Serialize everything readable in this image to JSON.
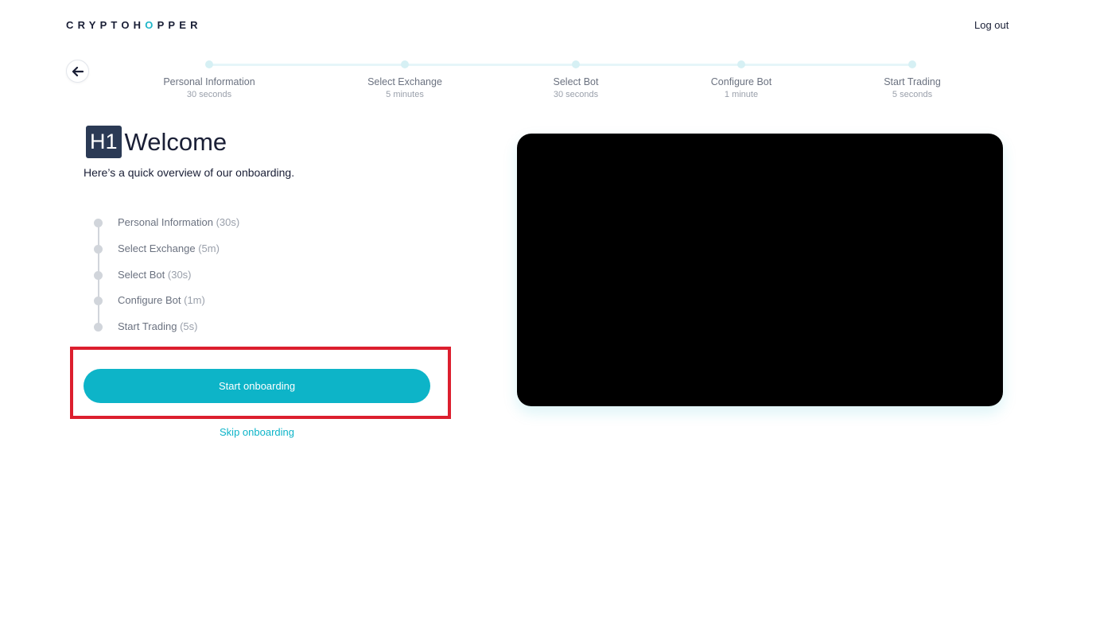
{
  "header": {
    "logo_text_1": "CRYPTOH",
    "logo_text_2": "O",
    "logo_text_3": "PPER",
    "logout_label": "Log out"
  },
  "stepper": {
    "steps": [
      {
        "label": "Personal Information",
        "duration": "30 seconds"
      },
      {
        "label": "Select Exchange",
        "duration": "5 minutes"
      },
      {
        "label": "Select Bot",
        "duration": "30 seconds"
      },
      {
        "label": "Configure Bot",
        "duration": "1 minute"
      },
      {
        "label": "Start Trading",
        "duration": "5 seconds"
      }
    ]
  },
  "main": {
    "h1_badge": "H1",
    "title": "Welcome",
    "subtitle": "Here’s a quick overview of our onboarding.",
    "overview": [
      {
        "label": "Personal Information",
        "time": "(30s)"
      },
      {
        "label": "Select Exchange",
        "time": "(5m)"
      },
      {
        "label": "Select Bot",
        "time": "(30s)"
      },
      {
        "label": "Configure Bot",
        "time": "(1m)"
      },
      {
        "label": "Start Trading",
        "time": "(5s)"
      }
    ],
    "start_button_label": "Start onboarding",
    "skip_link_label": "Skip onboarding"
  },
  "colors": {
    "accent": "#0db4c8",
    "highlight": "#dc1f2e",
    "badge_bg": "#2b3a55"
  },
  "icons": {
    "back": "arrow-left-icon"
  }
}
